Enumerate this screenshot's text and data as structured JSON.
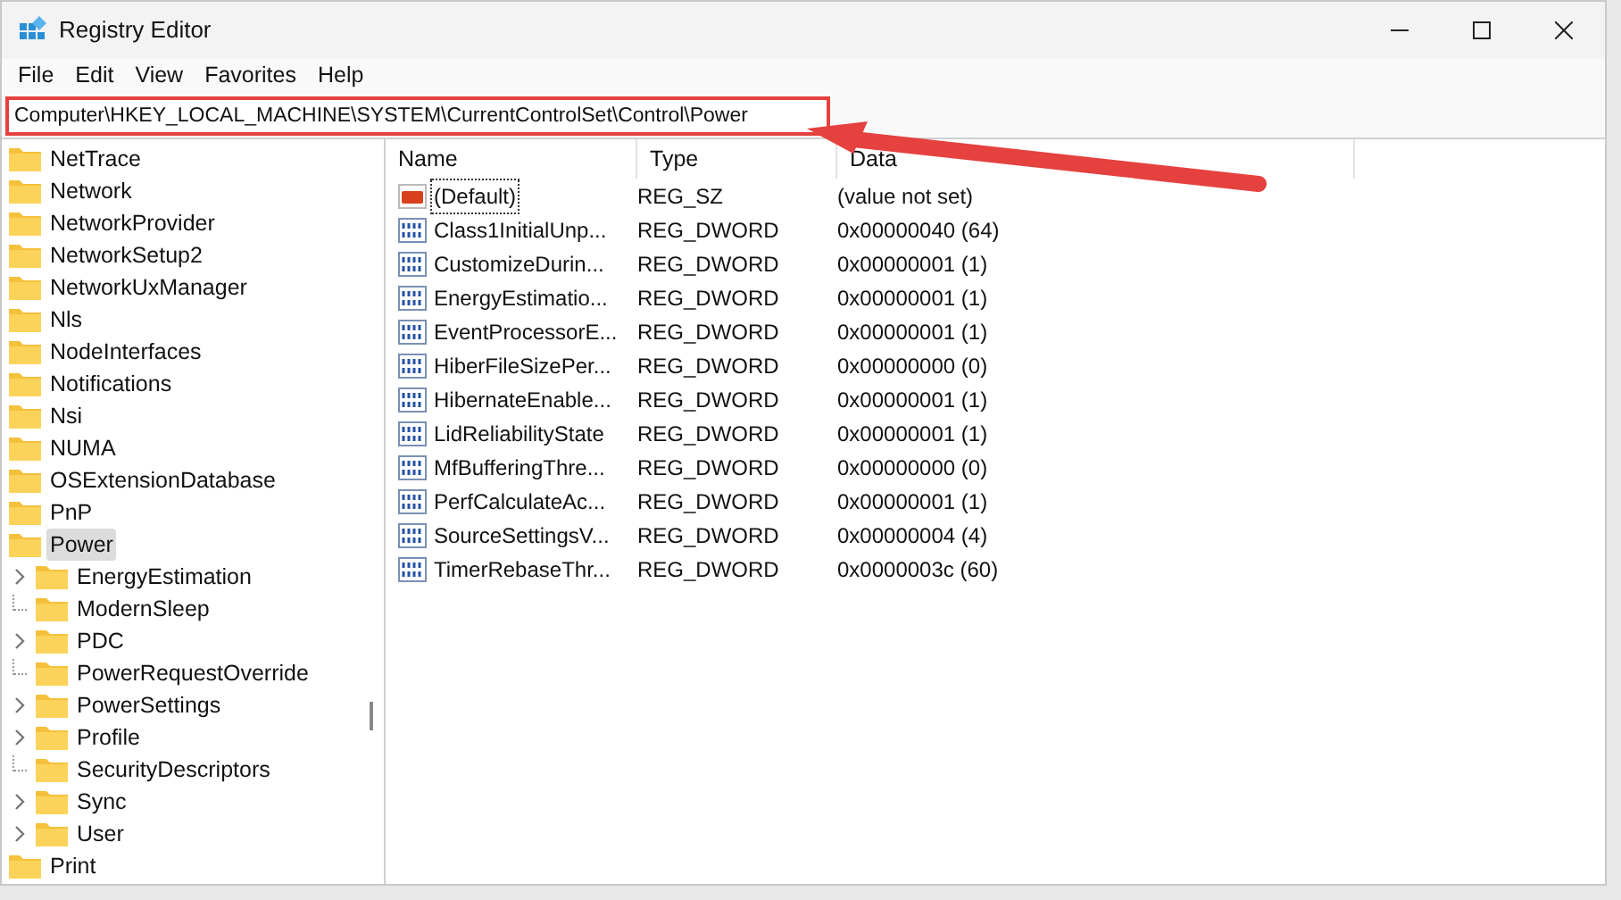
{
  "window": {
    "title": "Registry Editor"
  },
  "menu": [
    "File",
    "Edit",
    "View",
    "Favorites",
    "Help"
  ],
  "address": "Computer\\HKEY_LOCAL_MACHINE\\SYSTEM\\CurrentControlSet\\Control\\Power",
  "tree": [
    {
      "label": "NetTrace",
      "selected": false
    },
    {
      "label": "Network",
      "selected": false
    },
    {
      "label": "NetworkProvider",
      "selected": false
    },
    {
      "label": "NetworkSetup2",
      "selected": false
    },
    {
      "label": "NetworkUxManager",
      "selected": false
    },
    {
      "label": "Nls",
      "selected": false
    },
    {
      "label": "NodeInterfaces",
      "selected": false
    },
    {
      "label": "Notifications",
      "selected": false
    },
    {
      "label": "Nsi",
      "selected": false
    },
    {
      "label": "NUMA",
      "selected": false
    },
    {
      "label": "OSExtensionDatabase",
      "selected": false
    },
    {
      "label": "PnP",
      "selected": false
    },
    {
      "label": "Power",
      "selected": true,
      "children": [
        {
          "label": "EnergyEstimation",
          "selected": false,
          "expandable": true
        },
        {
          "label": "ModernSleep",
          "selected": false,
          "expandable": false
        },
        {
          "label": "PDC",
          "selected": false,
          "expandable": true
        },
        {
          "label": "PowerRequestOverride",
          "selected": false,
          "expandable": false
        },
        {
          "label": "PowerSettings",
          "selected": false,
          "expandable": true
        },
        {
          "label": "Profile",
          "selected": false,
          "expandable": true
        },
        {
          "label": "SecurityDescriptors",
          "selected": false,
          "expandable": false
        },
        {
          "label": "Sync",
          "selected": false,
          "expandable": true
        },
        {
          "label": "User",
          "selected": false,
          "expandable": true
        }
      ]
    },
    {
      "label": "Print",
      "selected": false
    }
  ],
  "table": {
    "columns": [
      "Name",
      "Type",
      "Data"
    ],
    "rows": [
      {
        "kind": "string",
        "name": "(Default)",
        "type": "REG_SZ",
        "data": "(value not set)",
        "focused": true
      },
      {
        "kind": "dword",
        "name": "Class1InitialUnp...",
        "type": "REG_DWORD",
        "data": "0x00000040 (64)",
        "focused": false
      },
      {
        "kind": "dword",
        "name": "CustomizeDurin...",
        "type": "REG_DWORD",
        "data": "0x00000001 (1)",
        "focused": false
      },
      {
        "kind": "dword",
        "name": "EnergyEstimatio...",
        "type": "REG_DWORD",
        "data": "0x00000001 (1)",
        "focused": false
      },
      {
        "kind": "dword",
        "name": "EventProcessorE...",
        "type": "REG_DWORD",
        "data": "0x00000001 (1)",
        "focused": false
      },
      {
        "kind": "dword",
        "name": "HiberFileSizePer...",
        "type": "REG_DWORD",
        "data": "0x00000000 (0)",
        "focused": false
      },
      {
        "kind": "dword",
        "name": "HibernateEnable...",
        "type": "REG_DWORD",
        "data": "0x00000001 (1)",
        "focused": false
      },
      {
        "kind": "dword",
        "name": "LidReliabilityState",
        "type": "REG_DWORD",
        "data": "0x00000001 (1)",
        "focused": false
      },
      {
        "kind": "dword",
        "name": "MfBufferingThre...",
        "type": "REG_DWORD",
        "data": "0x00000000 (0)",
        "focused": false
      },
      {
        "kind": "dword",
        "name": "PerfCalculateAc...",
        "type": "REG_DWORD",
        "data": "0x00000001 (1)",
        "focused": false
      },
      {
        "kind": "dword",
        "name": "SourceSettingsV...",
        "type": "REG_DWORD",
        "data": "0x00000004 (4)",
        "focused": false
      },
      {
        "kind": "dword",
        "name": "TimerRebaseThr...",
        "type": "REG_DWORD",
        "data": "0x0000003c (60)",
        "focused": false
      }
    ]
  }
}
